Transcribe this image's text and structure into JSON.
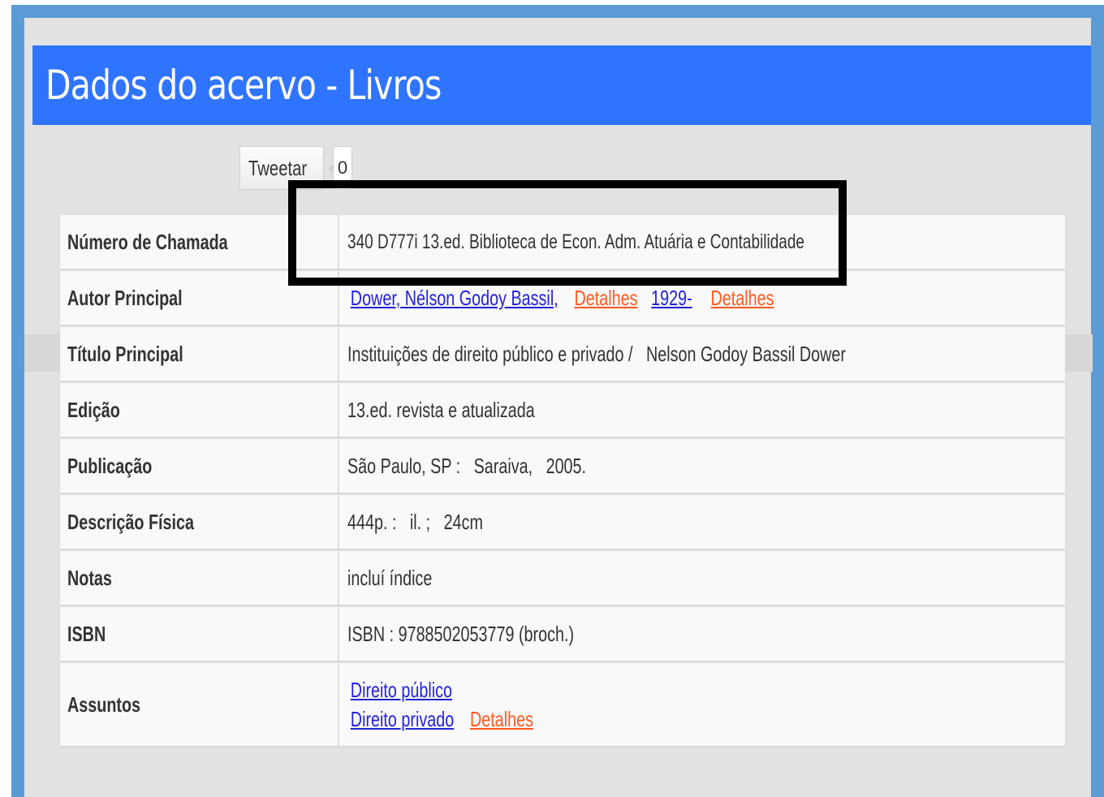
{
  "header": {
    "title": "Dados do acervo - Livros"
  },
  "share": {
    "tweet_label": "Tweetar",
    "tweet_count": "0"
  },
  "rows": [
    {
      "label": "Número de Chamada",
      "value": "340  D777i  13.ed.  Biblioteca de Econ. Adm. Atuária e Contabilidade"
    },
    {
      "label": "Autor Principal",
      "links": [
        "Dower, Nélson Godoy Bassil,",
        "1929-"
      ],
      "details_label": "Detalhes"
    },
    {
      "label": "Título Principal",
      "value": "Instituições de direito público e privado /   Nelson Godoy Bassil Dower"
    },
    {
      "label": "Edição",
      "value": "13.ed. revista e atualizada"
    },
    {
      "label": "Publicação",
      "value": "São Paulo, SP :   Saraiva,   2005."
    },
    {
      "label": "Descrição Física",
      "value": "444p. :   il. ;   24cm"
    },
    {
      "label": "Notas",
      "value": "incluí índice"
    },
    {
      "label": "ISBN",
      "value": "ISBN : 9788502053779 (broch.)"
    },
    {
      "label": "Assuntos",
      "links": [
        "Direito público",
        "Direito privado"
      ],
      "details_label": "Detalhes"
    }
  ],
  "colors": {
    "header_bg": "#2f74ff",
    "frame_border": "#5b9bd5",
    "link": "#2222dd",
    "details_link": "#ff5a1f"
  }
}
